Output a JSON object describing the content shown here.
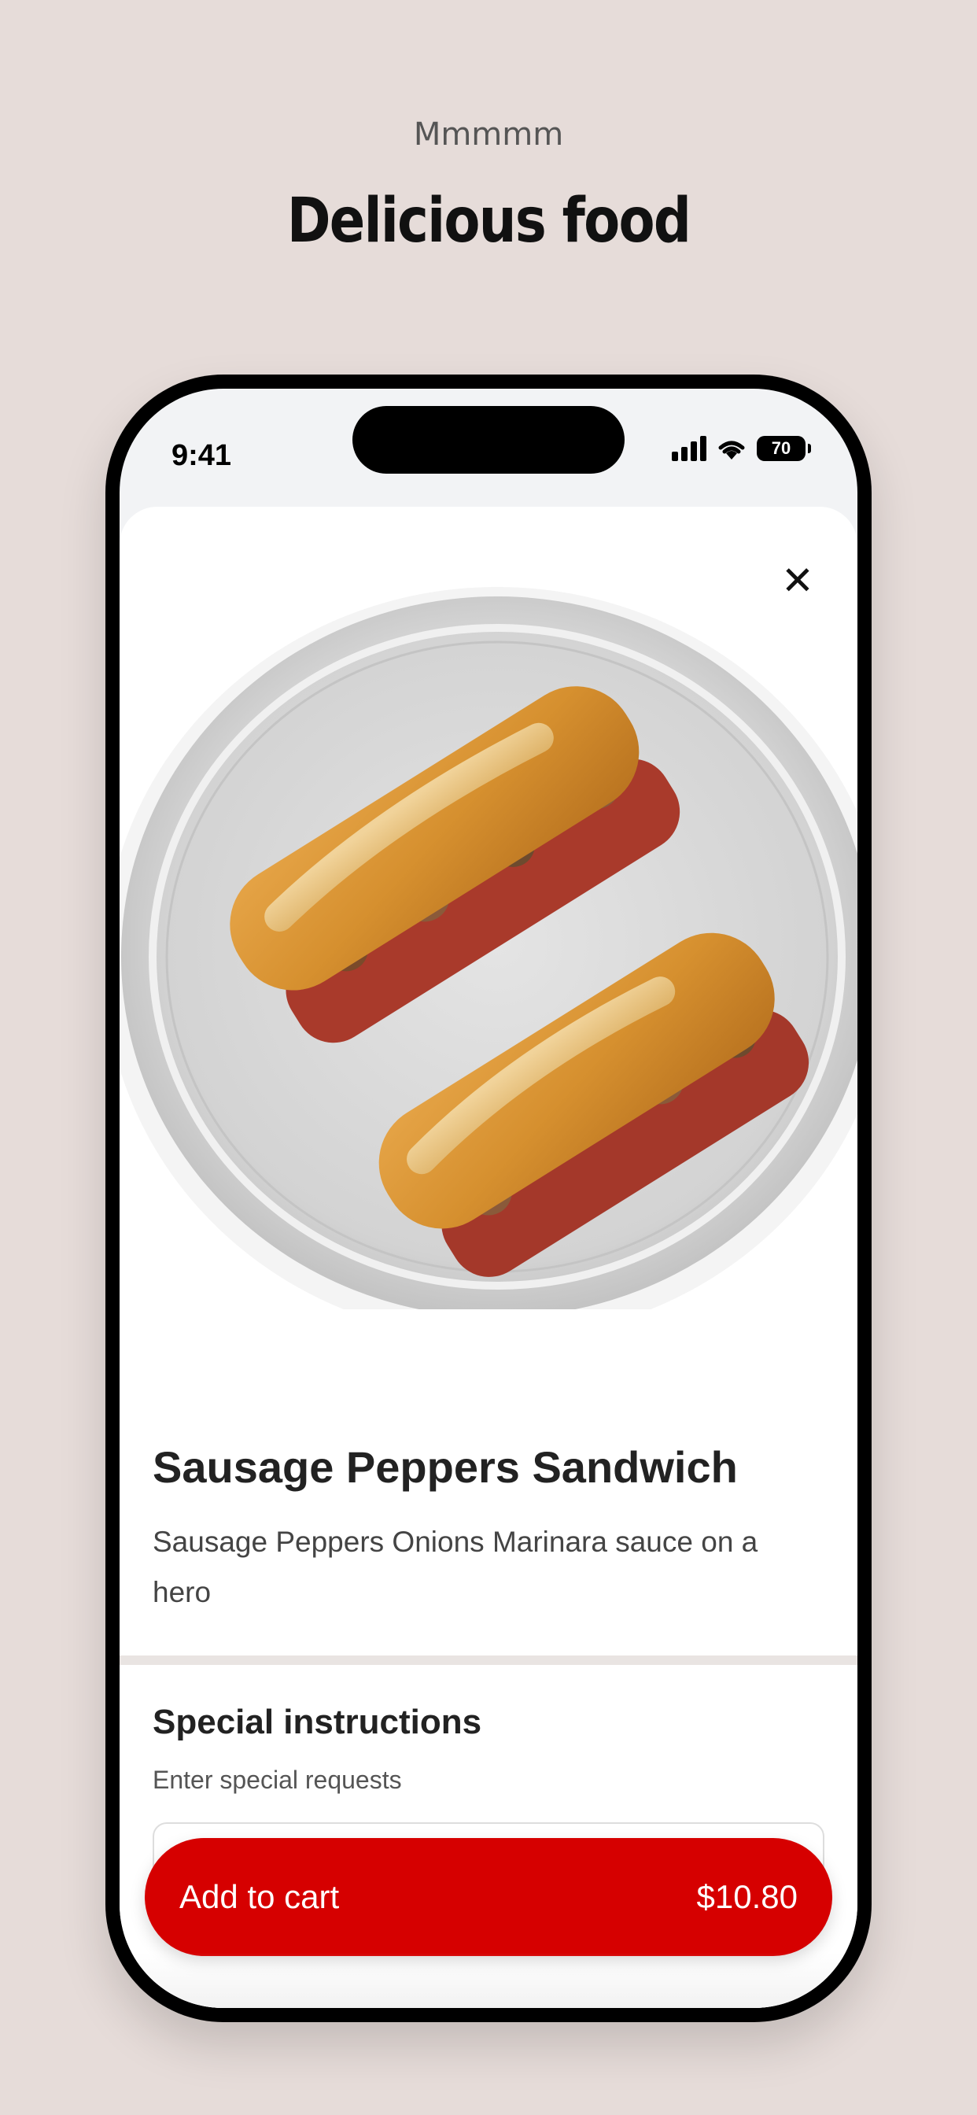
{
  "banner": {
    "eyebrow": "Mmmmm",
    "headline": "Delicious food"
  },
  "status_bar": {
    "time": "9:41",
    "battery": "70"
  },
  "item": {
    "title": "Sausage Peppers Sandwich",
    "description": "Sausage Peppers Onions Marinara sauce on a hero",
    "image_icon": "sandwich-photo"
  },
  "special_instructions": {
    "title": "Special instructions",
    "subtitle": "Enter special requests",
    "value": "",
    "placeholder": ""
  },
  "cart_button": {
    "label": "Add to cart",
    "price": "$10.80"
  },
  "colors": {
    "accent": "#d60000",
    "background": "#e6dcd9"
  }
}
